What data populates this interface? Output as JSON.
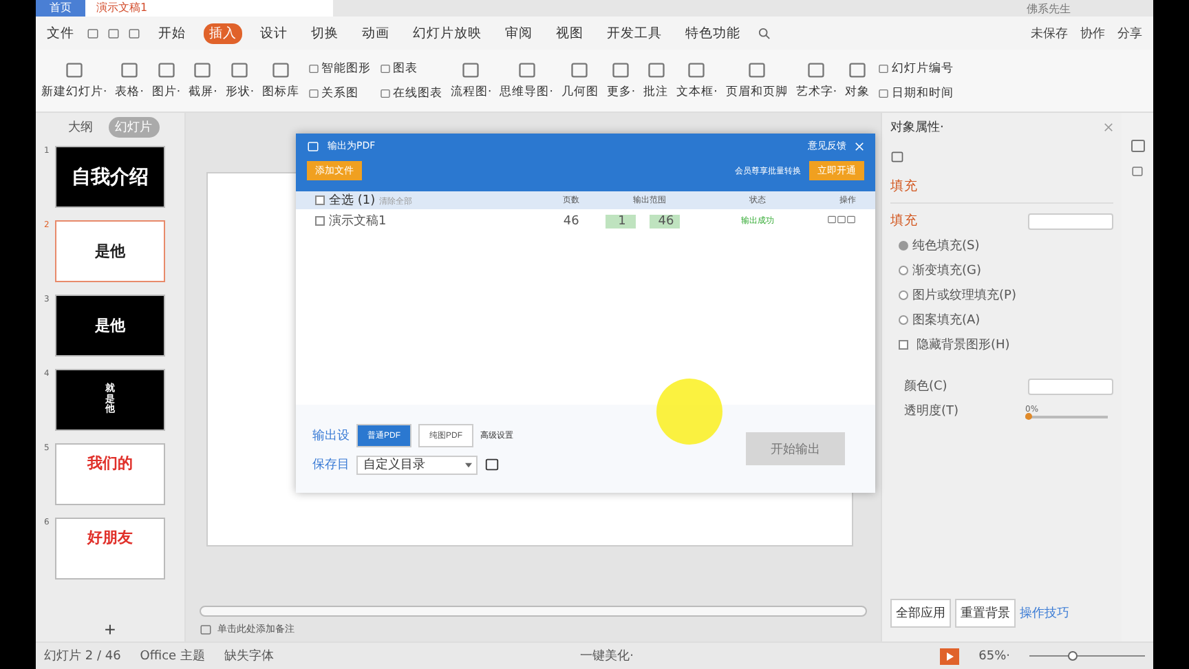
{
  "doc_tabs": [
    {
      "label": "首页",
      "kind": "home"
    },
    {
      "label": "演示文稿1",
      "kind": "doc"
    }
  ],
  "user": "佛系先生",
  "menu": {
    "file": "文件",
    "tabs": [
      {
        "label": "开始",
        "selected": false
      },
      {
        "label": "插入",
        "selected": true
      },
      {
        "label": "设计",
        "selected": false
      },
      {
        "label": "切换",
        "selected": false
      },
      {
        "label": "动画",
        "selected": false
      },
      {
        "label": "幻灯片放映",
        "selected": false
      },
      {
        "label": "审阅",
        "selected": false
      },
      {
        "label": "视图",
        "selected": false
      },
      {
        "label": "开发工具",
        "selected": false
      },
      {
        "label": "特色功能",
        "selected": false
      }
    ],
    "unsaved": "未保存",
    "collab": "协作",
    "share": "分享"
  },
  "ribbon": [
    {
      "kind": "large",
      "label": "新建幻灯片·"
    },
    {
      "kind": "large",
      "label": "表格·"
    },
    {
      "kind": "large",
      "label": "图片·"
    },
    {
      "kind": "large",
      "label": "截屏·"
    },
    {
      "kind": "large",
      "label": "形状·"
    },
    {
      "kind": "large",
      "label": "图标库"
    },
    {
      "kind": "pair",
      "top": "智能图形",
      "bottom": "关系图"
    },
    {
      "kind": "pair",
      "top": "图表",
      "bottom": "在线图表"
    },
    {
      "kind": "large",
      "label": "流程图·"
    },
    {
      "kind": "large",
      "label": "思维导图·"
    },
    {
      "kind": "large",
      "label": "几何图"
    },
    {
      "kind": "large",
      "label": "更多·"
    },
    {
      "kind": "large",
      "label": "批注"
    },
    {
      "kind": "large",
      "label": "文本框·"
    },
    {
      "kind": "large",
      "label": "页眉和页脚"
    },
    {
      "kind": "large",
      "label": "艺术字·"
    },
    {
      "kind": "large",
      "label": "对象"
    },
    {
      "kind": "pair",
      "top": "幻灯片编号",
      "bottom": "日期和时间"
    }
  ],
  "left_panel": {
    "tabs": [
      {
        "label": "大纲",
        "selected": false
      },
      {
        "label": "幻灯片",
        "selected": true
      }
    ],
    "slides": [
      {
        "number": "1",
        "text": "自我介绍",
        "kind": "dark",
        "selected": false
      },
      {
        "number": "2",
        "text": "是他",
        "kind": "light",
        "selected": true
      },
      {
        "number": "3",
        "text": "是他",
        "kind": "dark",
        "selected": false
      },
      {
        "number": "4",
        "text": "就是他",
        "kind": "dark-vertical",
        "selected": false
      },
      {
        "number": "5",
        "text": "我们的",
        "kind": "accent",
        "selected": false
      },
      {
        "number": "6",
        "text": "好朋友",
        "kind": "accent",
        "selected": false
      }
    ],
    "add": "+"
  },
  "dialog": {
    "title": "输出为PDF",
    "feedback": "意见反馈",
    "add_file": "添加文件",
    "promo": "会员尊享批量转换",
    "open": "立即开通",
    "select_all": {
      "label": "全选 (1)",
      "checked": false
    },
    "clear": "清除全部",
    "columns": [
      "页数",
      "输出范围",
      "状态",
      "操作"
    ],
    "files": [
      {
        "name": "演示文稿1",
        "checked": false,
        "pages": "46",
        "from": "1",
        "to": "46",
        "status": "输出成功"
      }
    ],
    "output_label": "输出设",
    "modes": [
      {
        "label": "普通PDF",
        "selected": true
      },
      {
        "label": "纯图PDF",
        "selected": false
      }
    ],
    "advanced": "高级设置",
    "save_label": "保存目",
    "save_dir": "自定义目录",
    "start": "开始输出"
  },
  "notes": "单击此处添加备注",
  "properties": {
    "title": "对象属性·",
    "tab": "填充",
    "section": "填充",
    "options": [
      {
        "kind": "radio",
        "label": "纯色填充(S)",
        "selected": true
      },
      {
        "kind": "radio",
        "label": "渐变填充(G)",
        "selected": false
      },
      {
        "kind": "radio",
        "label": "图片或纹理填充(P)",
        "selected": false
      },
      {
        "kind": "radio",
        "label": "图案填充(A)",
        "selected": false
      },
      {
        "kind": "checkbox",
        "label": "隐藏背景图形(H)",
        "checked": false
      }
    ],
    "color_label": "颜色(C)",
    "transparency_label": "透明度(T)",
    "transparency": {
      "level": 0,
      "reading": "0%"
    },
    "buttons": [
      "全部应用",
      "重置背景"
    ],
    "tips": "操作技巧"
  },
  "status_bar": {
    "slide": "幻灯片 2 / 46",
    "theme": "Office 主题",
    "fonts": "缺失字体",
    "beautify": "一键美化·",
    "zoom": "65%·",
    "zoom_slider": {
      "level": 0.35
    }
  }
}
